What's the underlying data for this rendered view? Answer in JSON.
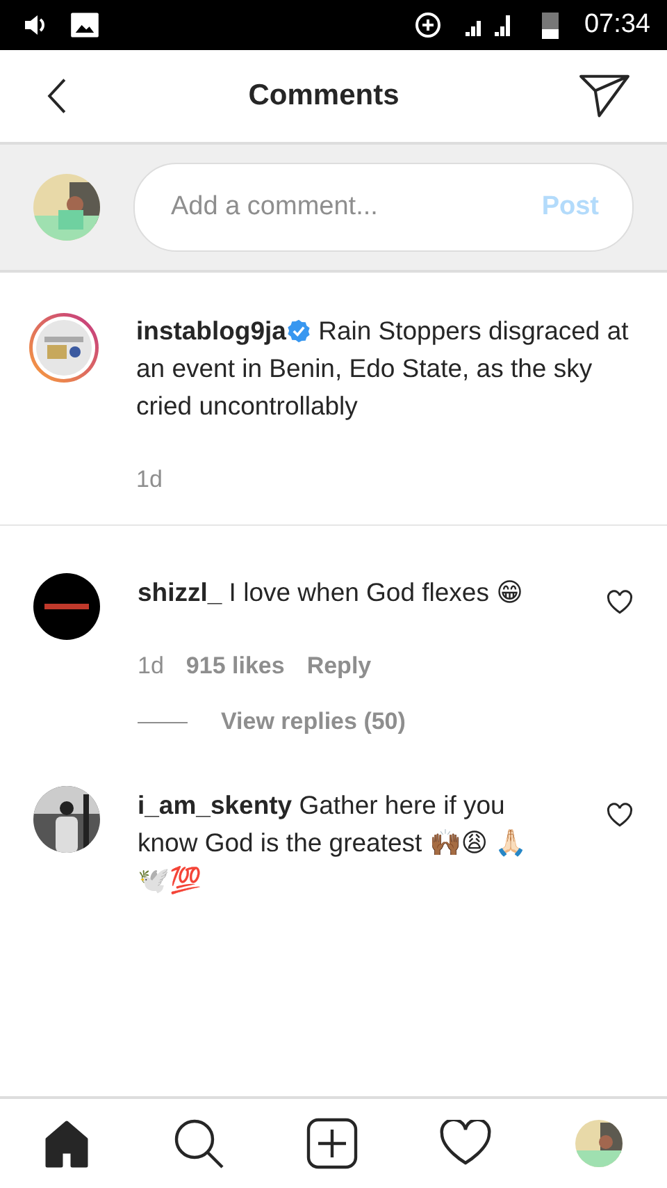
{
  "status_bar": {
    "time": "07:34"
  },
  "header": {
    "title": "Comments"
  },
  "composer": {
    "placeholder": "Add a comment...",
    "post_button": {
      "label": "Post",
      "disabled": true
    }
  },
  "caption": {
    "username": "instablog9ja",
    "verified": true,
    "text": "Rain Stoppers disgraced at an event in Benin, Edo State, as the sky cried uncontrollably",
    "time": "1d"
  },
  "comments": [
    {
      "username": "shizzl_",
      "text": "I love when God flexes 😁",
      "time": "1d",
      "likes": "915 likes",
      "reply": "Reply",
      "view_replies": "View replies (50)",
      "liked": false
    },
    {
      "username": "i_am_skenty",
      "text": "Gather here if you know God is the greatest 🙌🏾😩 🙏🏻🕊️💯",
      "liked": false
    }
  ],
  "nav": [
    {
      "kind": "home",
      "selected": true
    },
    {
      "kind": "search",
      "selected": false
    },
    {
      "kind": "add",
      "selected": false
    },
    {
      "kind": "activity",
      "selected": false
    },
    {
      "kind": "profile",
      "selected": false
    }
  ]
}
